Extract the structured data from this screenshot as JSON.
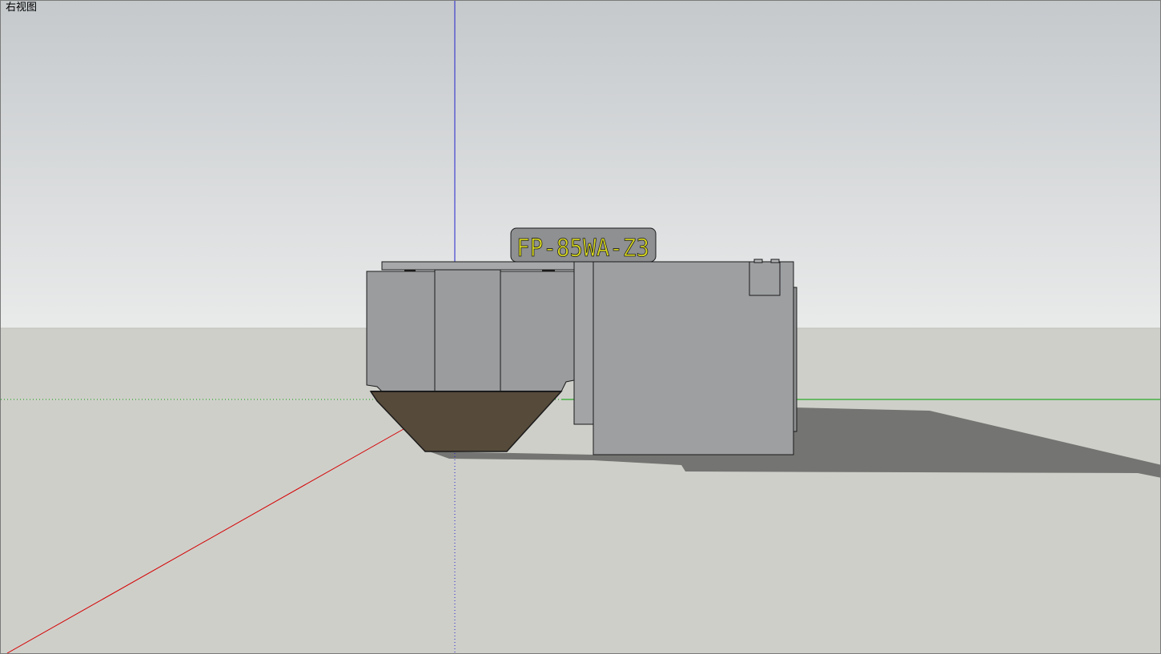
{
  "viewport": {
    "view_name": "右视图",
    "sky_top_color": "#c5c9cc",
    "sky_bottom_color": "#e9eaea",
    "ground_color": "#cfcfca"
  },
  "axes": {
    "red_axis_color": "#d40000",
    "green_axis_color": "#00a000",
    "blue_axis_color": "#2222cc"
  },
  "model": {
    "label_text": "FP-85WA-Z3",
    "label_text_color": "#d8d820",
    "body_color": "#9a9c9e",
    "hopper_color": "#564a3a",
    "shadow_color": "#747472"
  }
}
